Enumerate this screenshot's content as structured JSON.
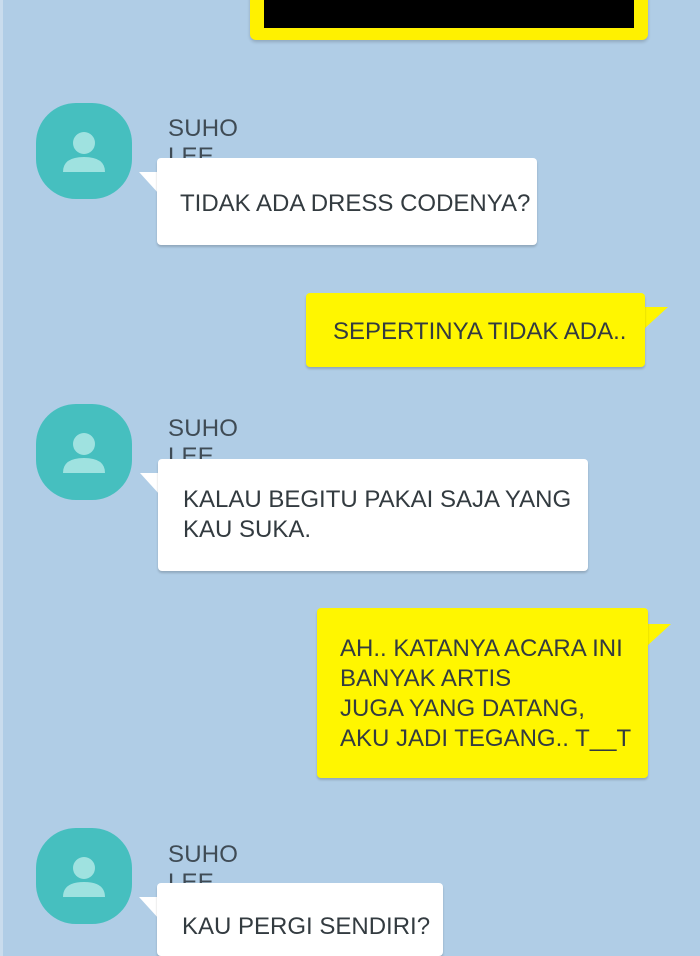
{
  "colors": {
    "background": "#b0cde6",
    "incoming_bubble": "#ffffff",
    "outgoing_bubble": "#fff600",
    "avatar": "#46bfbf",
    "text": "#333b40"
  },
  "messages": [
    {
      "direction": "in",
      "sender": "SUHO LEE",
      "avatar_icon": "person-icon",
      "text": "TIDAK ADA DRESS CODENYA?"
    },
    {
      "direction": "out",
      "text": "SEPERTINYA TIDAK ADA.."
    },
    {
      "direction": "in",
      "sender": "SUHO LEE",
      "avatar_icon": "person-icon",
      "text": "KALAU BEGITU PAKAI SAJA YANG\nKAU SUKA."
    },
    {
      "direction": "out",
      "text": "AH.. KATANYA ACARA INI\nBANYAK ARTIS\nJUGA YANG DATANG,\nAKU JADI TEGANG.. T__T"
    },
    {
      "direction": "in",
      "sender": "SUHO LEE",
      "avatar_icon": "person-icon",
      "text": "KAU PERGI SENDIRI?"
    }
  ]
}
